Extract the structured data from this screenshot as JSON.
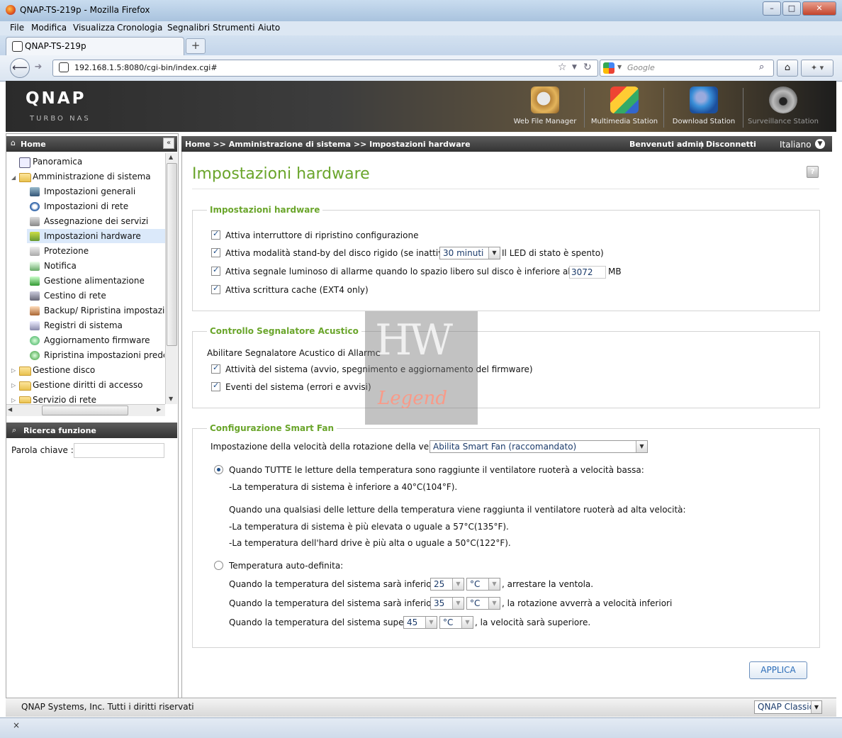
{
  "browser": {
    "window_title": "QNAP-TS-219p - Mozilla Firefox",
    "menu": [
      "File",
      "Modifica",
      "Visualizza",
      "Cronologia",
      "Segnalibri",
      "Strumenti",
      "Aiuto"
    ],
    "tab_title": "QNAP-TS-219p",
    "url": "192.168.1.5:8080/cgi-bin/index.cgi#",
    "search_placeholder": "Google",
    "status_close": "×"
  },
  "header": {
    "logo": "QNAP",
    "logo_sub": "TURBO NAS",
    "apps": [
      {
        "label": "Web File Manager",
        "icon": "web-file-manager-icon"
      },
      {
        "label": "Multimedia Station",
        "icon": "multimedia-station-icon"
      },
      {
        "label": "Download Station",
        "icon": "download-station-icon"
      },
      {
        "label": "Surveillance Station",
        "icon": "surveillance-station-icon"
      }
    ]
  },
  "sidebar": {
    "title": "Home",
    "items": [
      {
        "label": "Panoramica"
      },
      {
        "label": "Amministrazione di sistema"
      },
      {
        "label": "Impostazioni generali"
      },
      {
        "label": "Impostazioni di rete"
      },
      {
        "label": "Assegnazione dei servizi"
      },
      {
        "label": "Impostazioni hardware"
      },
      {
        "label": "Protezione"
      },
      {
        "label": "Notifica"
      },
      {
        "label": "Gestione alimentazione"
      },
      {
        "label": "Cestino di rete"
      },
      {
        "label": "Backup/ Ripristina impostazioni"
      },
      {
        "label": "Registri di sistema"
      },
      {
        "label": "Aggiornamento firmware"
      },
      {
        "label": "Ripristina impostazioni predefinite"
      },
      {
        "label": "Gestione disco"
      },
      {
        "label": "Gestione diritti di accesso"
      },
      {
        "label": "Servizio di rete"
      }
    ],
    "search_title": "Ricerca funzione",
    "keyword_label": "Parola chiave :"
  },
  "topbar": {
    "breadcrumb": "Home >> Amministrazione di sistema >> Impostazioni hardware",
    "welcome": "Benvenuti admin",
    "separator": "|",
    "logout": "Disconnetti",
    "language": "Italiano"
  },
  "page": {
    "title": "Impostazioni hardware",
    "help": "?",
    "hardware": {
      "legend": "Impostazioni hardware",
      "reset_switch": "Attiva interruttore di ripristino configurazione",
      "standby_prefix": "Attiva modalità stand-by del disco rigido (se inattivo per",
      "standby_value": "30 minuti",
      "standby_suffix": "Il LED di stato è spento)",
      "alarm_prefix": "Attiva segnale luminoso di allarme quando lo spazio libero sul disco è inferiore al valore:",
      "alarm_value": "3072",
      "alarm_unit": "MB",
      "cache": "Attiva scrittura cache (EXT4 only)"
    },
    "buzzer": {
      "legend": "Controllo Segnalatore Acustico",
      "intro": "Abilitare Segnalatore Acustico di Allarme",
      "system_activity": "Attività del sistema (avvio, spegnimento e aggiornamento del firmware)",
      "system_events": "Eventi del sistema (errori e avvisi)"
    },
    "fan": {
      "legend": "Configurazione Smart Fan",
      "speed_label": "Impostazione della velocità della rotazione della ventola:",
      "speed_value": "Abilita Smart Fan (raccomandato)",
      "all_low": "Quando TUTTE le letture della temperatura sono raggiunte il ventilatore ruoterà a velocità bassa:",
      "low_line1": "-La temperatura di sistema è inferiore a 40°C(104°F).",
      "any_high": "Quando una qualsiasi delle letture della temperatura viene raggiunta il ventilatore ruoterà ad alta velocità:",
      "high_line1": "-La temperatura di sistema è più elevata o uguale a 57°C(135°F).",
      "high_line2": "-La temperatura dell'hard drive è più alta o uguale a 50°C(122°F).",
      "custom": "Temperatura auto-definita:",
      "rule1_prefix": "Quando la temperatura del sistema sarà inferiore a",
      "rule1_value": "25",
      "rule1_unit": "°C",
      "rule1_suffix": ", arrestare la ventola.",
      "rule2_prefix": "Quando la temperatura del sistema sarà inferiore a",
      "rule2_value": "35",
      "rule2_unit": "°C",
      "rule2_suffix": ", la rotazione avverrà a velocità inferiori",
      "rule3_prefix": "Quando la temperatura del sistema supera i",
      "rule3_value": "45",
      "rule3_unit": "°C",
      "rule3_suffix": ", la velocità sarà superiore."
    },
    "apply": "APPLICA"
  },
  "watermark": {
    "line1": "HW",
    "line2": "Legend"
  },
  "footer": {
    "copyright": "QNAP Systems, Inc. Tutti i diritti riservati",
    "theme": "QNAP Classic"
  },
  "colors": {
    "accent_green": "#6aa52b",
    "header_dark": "#333333"
  }
}
